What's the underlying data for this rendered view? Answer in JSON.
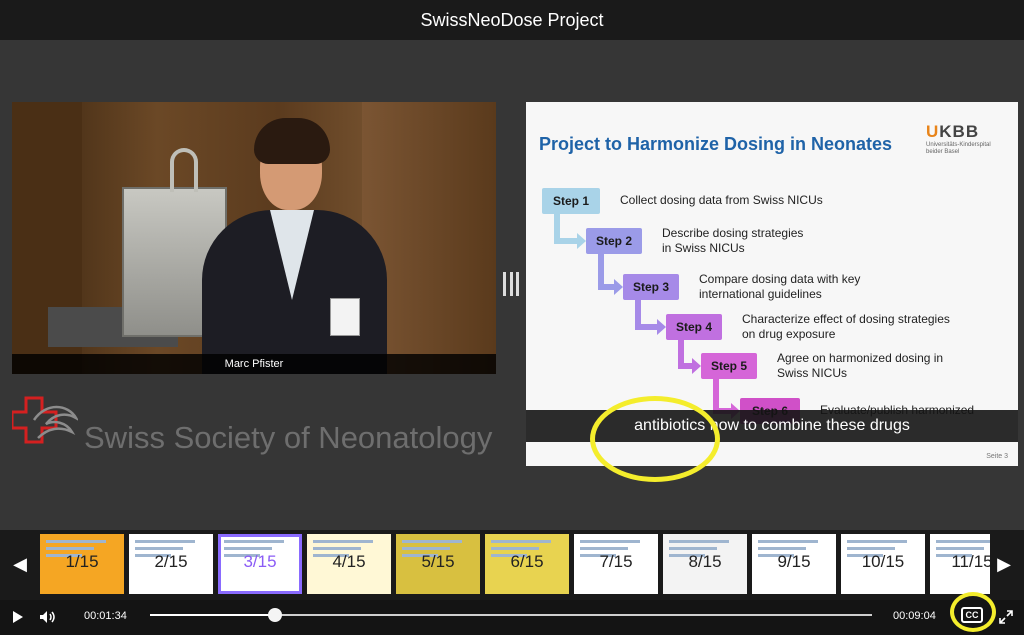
{
  "app": {
    "title": "SwissNeoDose Project"
  },
  "video": {
    "speaker_caption": "Marc Pfister"
  },
  "logo": {
    "text": "Swiss Society of Neonatology"
  },
  "slide": {
    "title": "Project to Harmonize Dosing in Neonates",
    "logo_name": "UKBB",
    "logo_name_u": "U",
    "logo_name_rest": "KBB",
    "logo_sub_1": "Universitäts-Kinderspital",
    "logo_sub_2": "beider Basel",
    "steps": [
      {
        "label": "Step 1",
        "text": "Collect dosing data from Swiss NICUs",
        "color": "#a9d3e8"
      },
      {
        "label": "Step 2",
        "text": "Describe dosing strategies\nin Swiss NICUs",
        "color": "#9b9be8"
      },
      {
        "label": "Step 3",
        "text": "Compare dosing data with key\ninternational guidelines",
        "color": "#a68ae8"
      },
      {
        "label": "Step 4",
        "text": "Characterize effect of dosing strategies\non drug exposure",
        "color": "#c070e0"
      },
      {
        "label": "Step 5",
        "text": "Agree on harmonized dosing in\nSwiss NICUs",
        "color": "#d566d8"
      },
      {
        "label": "Step 6",
        "text": "Evaluate/publish harmonized",
        "color": "#d050c8"
      }
    ],
    "subtitle": "antibiotics how to combine these drugs",
    "slide_number": "Seite 3"
  },
  "filmstrip": {
    "thumbs": [
      {
        "label": "1/15"
      },
      {
        "label": "2/15"
      },
      {
        "label": "3/15",
        "active": true
      },
      {
        "label": "4/15"
      },
      {
        "label": "5/15"
      },
      {
        "label": "6/15"
      },
      {
        "label": "7/15"
      },
      {
        "label": "8/15"
      },
      {
        "label": "9/15"
      },
      {
        "label": "10/15"
      },
      {
        "label": "11/15"
      }
    ],
    "prev_icon": "arrow-left-icon",
    "next_icon": "arrow-right-icon"
  },
  "player": {
    "current_time": "00:01:34",
    "total_time": "00:09:04",
    "progress": 0.173,
    "cc_label": "CC",
    "icons": [
      "play-icon",
      "volume-icon",
      "cc-icon",
      "fullscreen-icon"
    ]
  },
  "colors": {
    "highlight": "#f4ed2c",
    "active_thumb": "#8a6bff",
    "title_blue": "#1f63a8"
  }
}
